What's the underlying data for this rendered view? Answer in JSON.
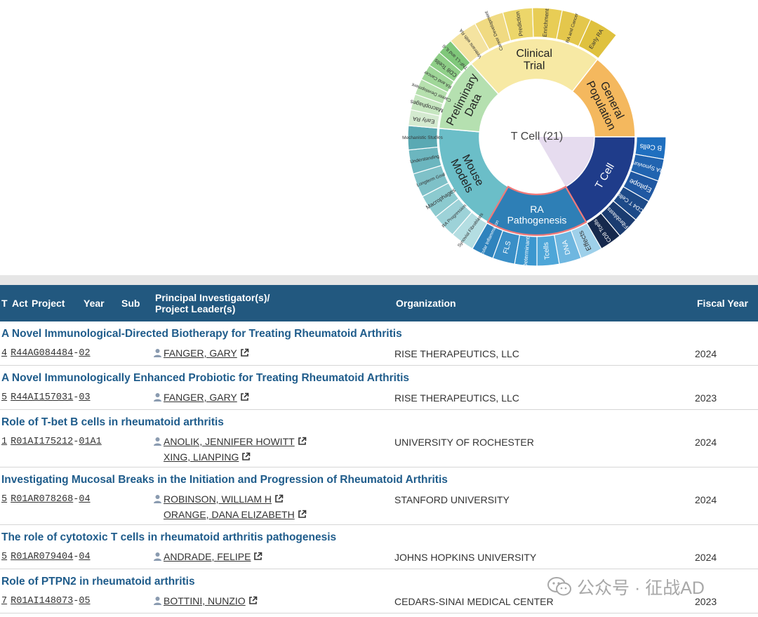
{
  "sunburst": {
    "center_label": "T Cell (21)",
    "categories": [
      {
        "label": "Clinical Trial",
        "lines": [
          "Clinical",
          "Trial"
        ],
        "color": "#f7e9a4"
      },
      {
        "label": "General Population",
        "lines": [
          "General",
          "Population"
        ],
        "color": "#f4b85e"
      },
      {
        "label": "T Cell",
        "lines": [
          "T Cell"
        ],
        "color": "#1f3c8a"
      },
      {
        "label": "RA Pathogenesis",
        "lines": [
          "RA",
          "Pathogenesis"
        ],
        "color": "#2e7fb6"
      },
      {
        "label": "Mouse Models",
        "lines": [
          "Mouse",
          "Models"
        ],
        "color": "#6bbec8"
      },
      {
        "label": "Preliminary Data",
        "lines": [
          "Preliminary",
          "Data"
        ],
        "color": "#b5e0b0"
      }
    ],
    "subcategories": [
      {
        "label": "Veterans with RA",
        "color": "#f4e3a0"
      },
      {
        "label": "Career Development",
        "color": "#f0da82"
      },
      {
        "label": "Prediction",
        "color": "#ecd66a"
      },
      {
        "label": "Enrichment",
        "color": "#e8cd55"
      },
      {
        "label": "RA and Cancer",
        "color": "#e4c74c"
      },
      {
        "label": "Early RA",
        "color": "#dfc13e"
      },
      {
        "label": "B Cells",
        "color": "#1f6fbf"
      },
      {
        "label": "RA Synovium",
        "color": "#2164b0"
      },
      {
        "label": "Epitope",
        "color": "#2058a2"
      },
      {
        "label": "CD4 T Cells",
        "color": "#1d4a88"
      },
      {
        "label": "Fibroblasts",
        "color": "#1b3c70"
      },
      {
        "label": "CD8 Tcells",
        "color": "#16294d"
      },
      {
        "label": "Effects",
        "color": "#9ed0ea"
      },
      {
        "label": "DNA",
        "color": "#6fb7e0"
      },
      {
        "label": "Tcells",
        "color": "#4ea6d8"
      },
      {
        "label": "Determinants",
        "color": "#3b97cf"
      },
      {
        "label": "FLS",
        "color": "#3a8fc7"
      },
      {
        "label": "Articular Inflammation",
        "color": "#2f83bd"
      },
      {
        "label": "Synovial Fibroblasts",
        "color": "#b4dee2"
      },
      {
        "label": "RA Progression",
        "color": "#9dd2d8"
      },
      {
        "label": "Macrophages",
        "color": "#8ccacf"
      },
      {
        "label": "Longterm Goal",
        "color": "#7fc1c8"
      },
      {
        "label": "Understanding",
        "color": "#6cb6bf"
      },
      {
        "label": "Mechanistic Studies",
        "color": "#5aa9b3"
      },
      {
        "label": "Early RA",
        "color": "#d4ead0"
      },
      {
        "label": "Macrophages",
        "color": "#c6e6c0"
      },
      {
        "label": "Career Development",
        "color": "#b6e0ae"
      },
      {
        "label": "RA and Cancer",
        "color": "#9fd698"
      },
      {
        "label": "CD8 Tcells",
        "color": "#8fcf88"
      },
      {
        "label": "TNF-L1 and IL-6",
        "color": "#7fc77a"
      }
    ]
  },
  "table": {
    "headers": {
      "type": "T",
      "act": "Act",
      "project": "Project",
      "year": "Year",
      "sub": "Sub",
      "pi_line1": "Principal Investigator(s)/",
      "pi_line2": "Project Leader(s)",
      "organization": "Organization",
      "fiscal_year": "Fiscal Year"
    },
    "rows": [
      {
        "title": "A Novel Immunological-Directed Biotherapy for Treating Rheumatoid Arthritis",
        "type": "4",
        "act": "R44",
        "ic": "AG",
        "serial": "084484",
        "sep": "-",
        "sub": "02",
        "pis": [
          "FANGER, GARY"
        ],
        "organization": "RISE THERAPEUTICS, LLC",
        "fiscal_year": "2024"
      },
      {
        "title": "A Novel Immunologically Enhanced Probiotic for Treating Rheumatoid Arthritis",
        "type": "5",
        "act": "R44",
        "ic": "AI",
        "serial": "157031",
        "sep": "-",
        "sub": "03",
        "pis": [
          "FANGER, GARY"
        ],
        "organization": "RISE THERAPEUTICS, LLC",
        "fiscal_year": "2023"
      },
      {
        "title": "Role of T-bet B cells in rheumatoid arthritis",
        "type": "1",
        "act": "R01",
        "ic": "AI",
        "serial": "175212",
        "sep": "-",
        "sub": "01A1",
        "pis": [
          "ANOLIK, JENNIFER HOWITT",
          "XING, LIANPING"
        ],
        "organization": "UNIVERSITY OF ROCHESTER",
        "fiscal_year": "2024"
      },
      {
        "title": "Investigating Mucosal Breaks in the Initiation and Progression of Rheumatoid Arthritis",
        "type": "5",
        "act": "R01",
        "ic": "AR",
        "serial": "078268",
        "sep": "-",
        "sub": "04",
        "pis": [
          "ROBINSON, WILLIAM H",
          "ORANGE, DANA ELIZABETH"
        ],
        "organization": "STANFORD UNIVERSITY",
        "fiscal_year": "2024"
      },
      {
        "title": "The role of cytotoxic T cells in rheumatoid arthritis pathogenesis",
        "type": "5",
        "act": "R01",
        "ic": "AR",
        "serial": "079404",
        "sep": "-",
        "sub": "04",
        "pis": [
          "ANDRADE, FELIPE"
        ],
        "organization": "JOHNS HOPKINS UNIVERSITY",
        "fiscal_year": "2024"
      },
      {
        "title": "Role of PTPN2 in rheumatoid arthritis",
        "type": "7",
        "act": "R01",
        "ic": "AI",
        "serial": "148073",
        "sep": "-",
        "sub": "05",
        "pis": [
          "BOTTINI, NUNZIO"
        ],
        "organization": "CEDARS-SINAI MEDICAL CENTER",
        "fiscal_year": "2023"
      }
    ]
  },
  "watermark": {
    "text": "公众号 · 征战AD"
  }
}
